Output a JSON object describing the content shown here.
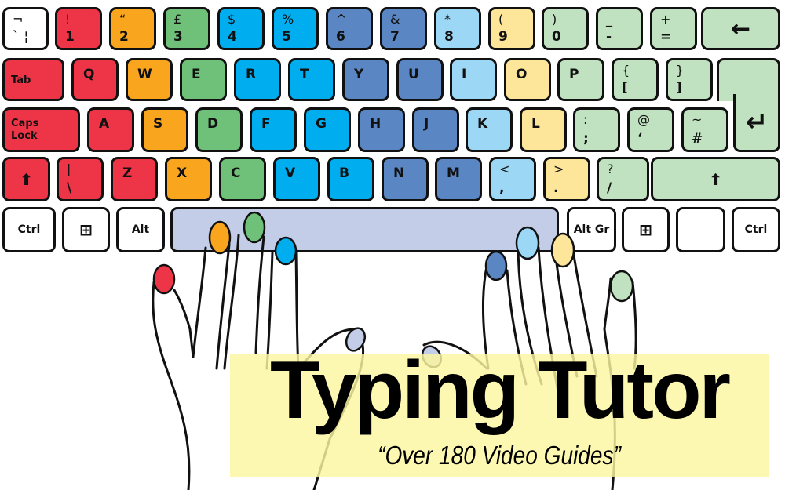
{
  "colors": {
    "red": "#ee3447",
    "orange": "#f9a61e",
    "green": "#6fc17a",
    "blue": "#00aeef",
    "navy": "#5a86c4",
    "light_blue": "#9cd7f5",
    "yellow": "#fde59a",
    "mint": "#c0e2c0",
    "space": "#c3cde8",
    "banner": "#fdf6a0"
  },
  "keyboard": {
    "row1": [
      {
        "top": "¬",
        "bottom": "` ¦",
        "color": "white"
      },
      {
        "top": "!",
        "bottom": "1",
        "color": "red"
      },
      {
        "top": "“",
        "bottom": "2",
        "color": "orange"
      },
      {
        "top": "£",
        "bottom": "3",
        "color": "green"
      },
      {
        "top": "$",
        "bottom": "4",
        "color": "blue"
      },
      {
        "top": "%",
        "bottom": "5",
        "color": "blue"
      },
      {
        "top": "^",
        "bottom": "6",
        "color": "navy"
      },
      {
        "top": "&",
        "bottom": "7",
        "color": "navy"
      },
      {
        "top": "*",
        "bottom": "8",
        "color": "light_blue"
      },
      {
        "top": "(",
        "bottom": "9",
        "color": "yellow"
      },
      {
        "top": ")",
        "bottom": "0",
        "color": "mint"
      },
      {
        "top": "_",
        "bottom": "-",
        "color": "mint"
      },
      {
        "top": "+",
        "bottom": "=",
        "color": "mint"
      },
      {
        "label": "←",
        "color": "mint",
        "icon": "backspace-arrow-icon"
      }
    ],
    "row2": [
      {
        "label": "Tab",
        "color": "red"
      },
      {
        "label": "Q",
        "color": "red"
      },
      {
        "label": "W",
        "color": "orange"
      },
      {
        "label": "E",
        "color": "green"
      },
      {
        "label": "R",
        "color": "blue"
      },
      {
        "label": "T",
        "color": "blue"
      },
      {
        "label": "Y",
        "color": "navy"
      },
      {
        "label": "U",
        "color": "navy"
      },
      {
        "label": "I",
        "color": "light_blue"
      },
      {
        "label": "O",
        "color": "yellow"
      },
      {
        "label": "P",
        "color": "mint"
      },
      {
        "top": "{",
        "bottom": "[",
        "color": "mint"
      },
      {
        "top": "}",
        "bottom": "]",
        "color": "mint"
      }
    ],
    "row3": [
      {
        "label": "Caps Lock",
        "color": "red"
      },
      {
        "label": "A",
        "color": "red"
      },
      {
        "label": "S",
        "color": "orange"
      },
      {
        "label": "D",
        "color": "green"
      },
      {
        "label": "F",
        "color": "blue"
      },
      {
        "label": "G",
        "color": "blue"
      },
      {
        "label": "H",
        "color": "navy"
      },
      {
        "label": "J",
        "color": "navy"
      },
      {
        "label": "K",
        "color": "light_blue"
      },
      {
        "label": "L",
        "color": "yellow"
      },
      {
        "top": ":",
        "bottom": ";",
        "color": "mint"
      },
      {
        "top": "@",
        "bottom": "‘",
        "color": "mint"
      },
      {
        "top": "~",
        "bottom": "#",
        "color": "mint"
      }
    ],
    "enter": {
      "label": "↵",
      "color": "mint",
      "icon": "enter-arrow-icon"
    },
    "row4": [
      {
        "label": "⬆",
        "color": "red",
        "icon": "shift-arrow-icon"
      },
      {
        "top": "|",
        "bottom": "\\",
        "color": "red"
      },
      {
        "label": "Z",
        "color": "red"
      },
      {
        "label": "X",
        "color": "orange"
      },
      {
        "label": "C",
        "color": "green"
      },
      {
        "label": "V",
        "color": "blue"
      },
      {
        "label": "B",
        "color": "blue"
      },
      {
        "label": "N",
        "color": "navy"
      },
      {
        "label": "M",
        "color": "navy"
      },
      {
        "top": "<",
        "bottom": ",",
        "color": "light_blue"
      },
      {
        "top": ">",
        "bottom": ".",
        "color": "yellow"
      },
      {
        "top": "?",
        "bottom": "/",
        "color": "mint"
      },
      {
        "label": "⬆",
        "color": "mint",
        "icon": "shift-arrow-icon"
      }
    ],
    "row5": [
      {
        "label": "Ctrl",
        "color": "white"
      },
      {
        "label": "⊞",
        "color": "white",
        "icon": "windows-logo-icon"
      },
      {
        "label": "Alt",
        "color": "white"
      },
      {
        "label": "",
        "color": "space",
        "name": "space-bar"
      },
      {
        "label": "Alt Gr",
        "color": "white"
      },
      {
        "label": "⊞",
        "color": "white",
        "icon": "windows-logo-icon"
      },
      {
        "label": "",
        "color": "white",
        "name": "menu-key"
      },
      {
        "label": "Ctrl",
        "color": "white"
      }
    ]
  },
  "fingers": {
    "left": [
      "red",
      "orange",
      "green",
      "blue",
      "space"
    ],
    "right": [
      "space",
      "navy",
      "light_blue",
      "yellow",
      "mint"
    ]
  },
  "banner": {
    "title": "Typing Tutor",
    "subtitle": "“Over 180 Video Guides”"
  }
}
